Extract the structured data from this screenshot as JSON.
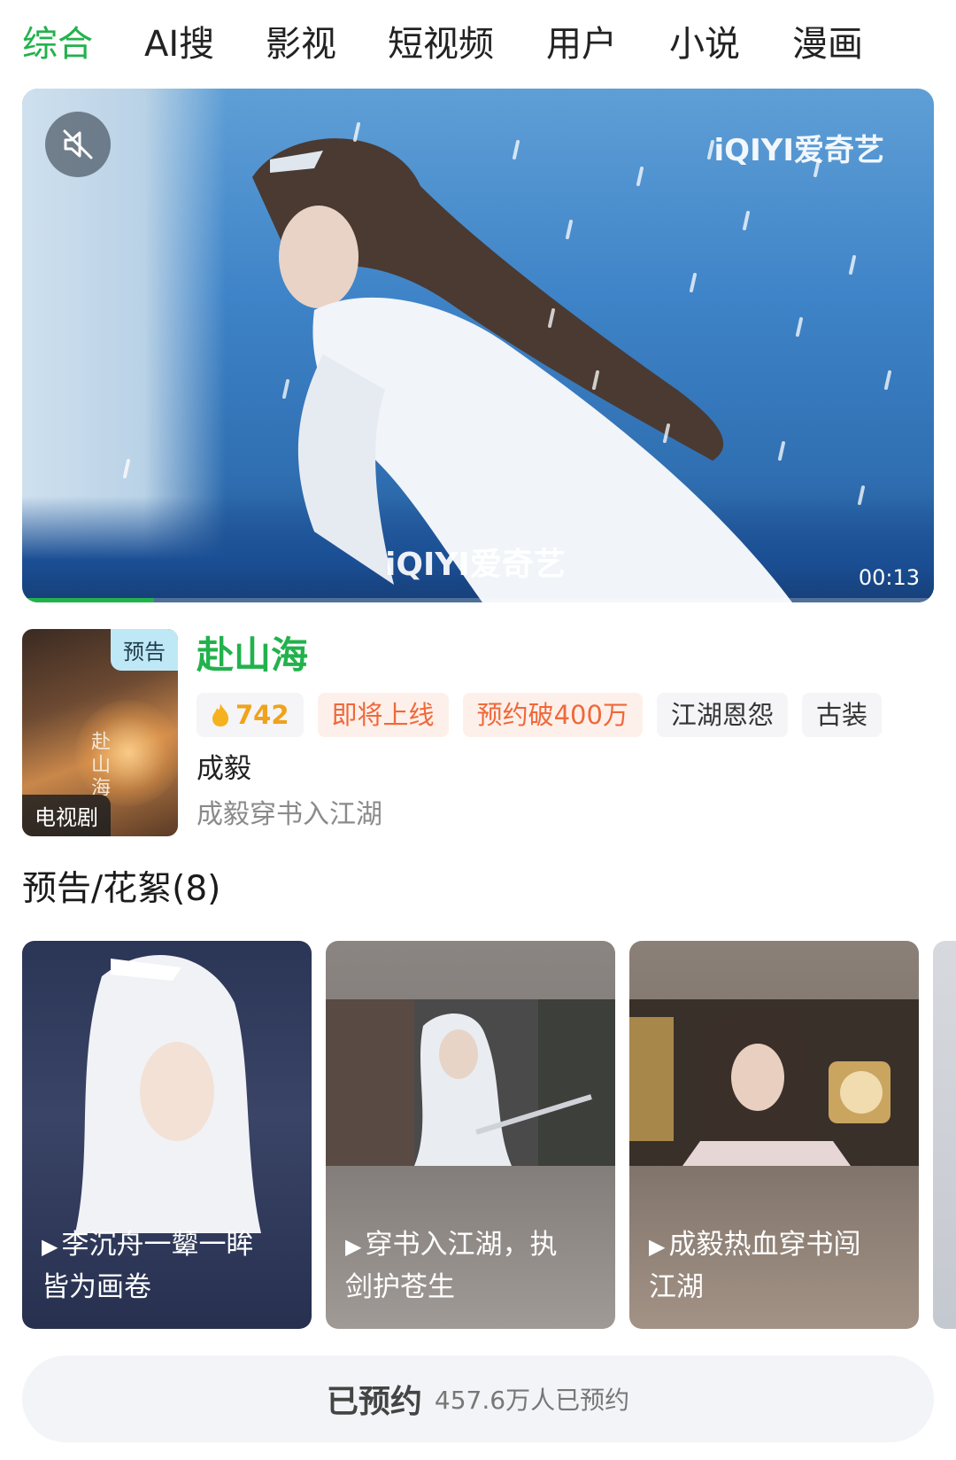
{
  "tabs": [
    {
      "label": "综合",
      "active": true
    },
    {
      "label": "AI搜",
      "active": false
    },
    {
      "label": "影视",
      "active": false
    },
    {
      "label": "短视频",
      "active": false
    },
    {
      "label": "用户",
      "active": false
    },
    {
      "label": "小说",
      "active": false
    },
    {
      "label": "漫画",
      "active": false
    }
  ],
  "player": {
    "watermark": "iQIYI爱奇艺",
    "duration": "00:13",
    "progress": 0.145,
    "muted": true,
    "icon": "muted-speaker-icon"
  },
  "show": {
    "poster_badge": "预告",
    "poster_type": "电视剧",
    "poster_title": "赴山海",
    "title": "赴山海",
    "heat": "742",
    "tags": [
      "即将上线",
      "预约破400万",
      "江湖恩怨",
      "古装"
    ],
    "actor": "成毅",
    "description": "成毅穿书入江湖"
  },
  "section": {
    "title": "预告/花絮(8)"
  },
  "clips": [
    {
      "title_line1": "李沉舟一颦一眸",
      "title_line2": "皆为画卷"
    },
    {
      "title_line1": "穿书入江湖，执",
      "title_line2": "剑护苍生"
    },
    {
      "title_line1": "成毅热血穿书闯",
      "title_line2": "江湖"
    }
  ],
  "reserve": {
    "label": "已预约",
    "count_text": "457.6万人已预约"
  },
  "colors": {
    "accent_green": "#22b24c",
    "tag_orange": "#f0683a",
    "heat_gold": "#f0a21c"
  }
}
